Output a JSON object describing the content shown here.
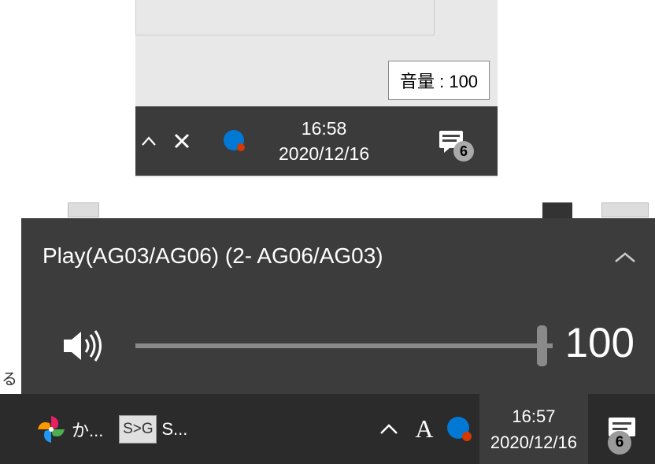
{
  "taskbar_small": {
    "time": "16:58",
    "date": "2020/12/16",
    "badge": "6"
  },
  "volume_tooltip": "音量 : 100",
  "volume_flyout": {
    "device": "Play(AG03/AG06) (2- AG06/AG03)",
    "value": "100",
    "percent": 100
  },
  "bottom_text": "る ",
  "taskbar": {
    "app1_label": "か...",
    "app2_label": "S...",
    "app2_icon": "S>G",
    "ime": "A",
    "time": "16:57",
    "date": "2020/12/16",
    "badge": "6"
  }
}
